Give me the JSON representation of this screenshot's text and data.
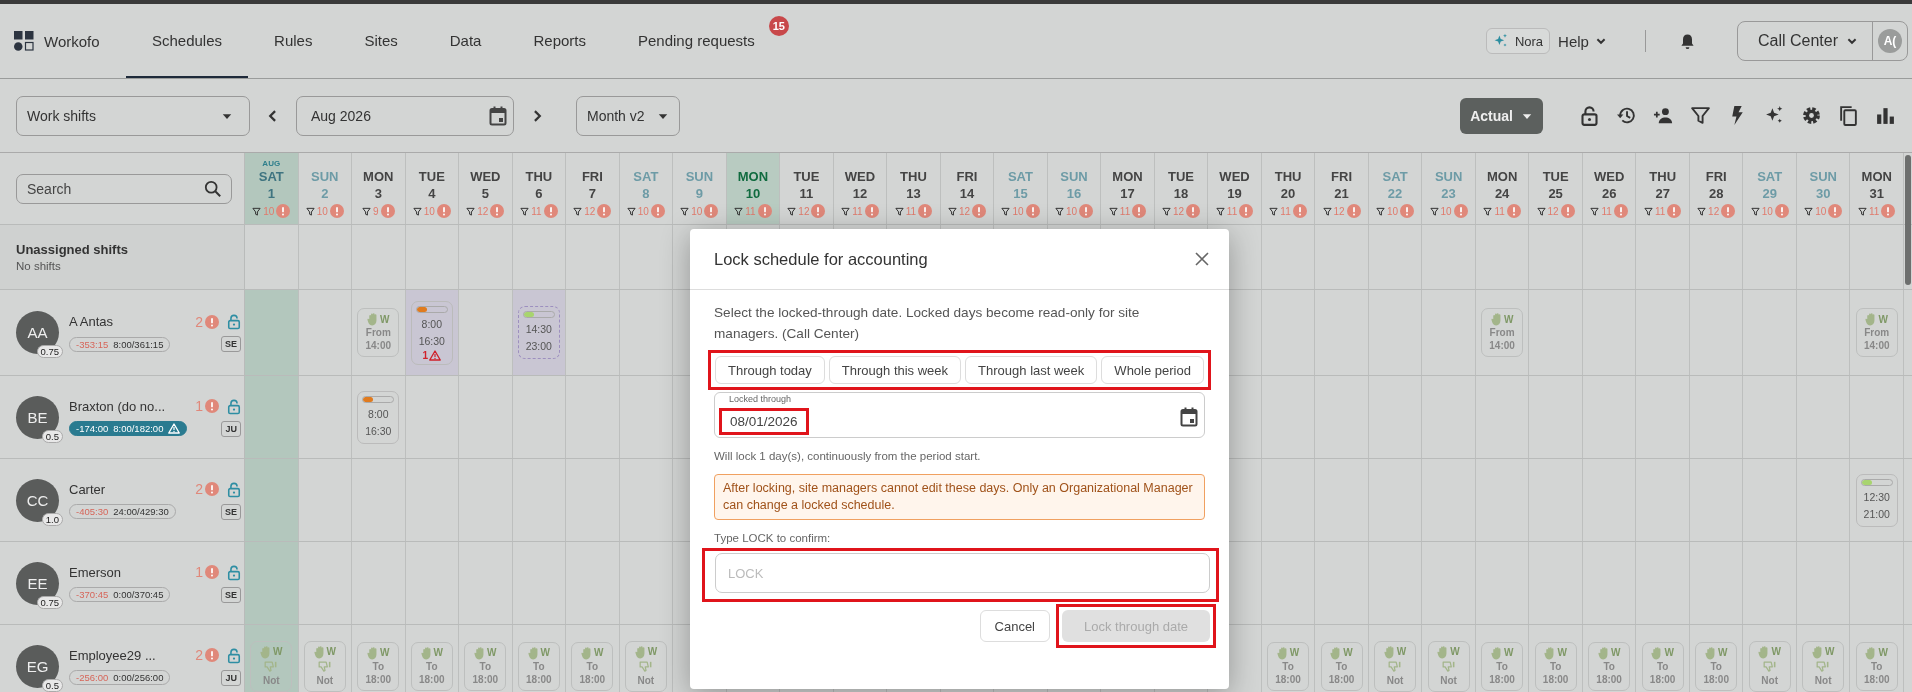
{
  "nav": {
    "logo": "Workofo",
    "assistant": "Nora",
    "help": "Help",
    "site": "Call Center",
    "avatar": "A(",
    "tabs": [
      {
        "label": "Schedules",
        "selected": true
      },
      {
        "label": "Rules",
        "selected": false
      },
      {
        "label": "Sites",
        "selected": false
      },
      {
        "label": "Data",
        "selected": false
      },
      {
        "label": "Reports",
        "selected": false
      },
      {
        "label": "Pending requests",
        "selected": false,
        "badge": "15"
      }
    ]
  },
  "toolbar": {
    "view_select": "Work shifts",
    "period": "Aug 2026",
    "mode_select": "Month v2",
    "scenario": "Actual"
  },
  "search": {
    "placeholder": "Search"
  },
  "unassigned": {
    "title": "Unassigned shifts",
    "subtitle": "No shifts"
  },
  "days": [
    {
      "weekday": "SAT",
      "date": "1",
      "count": "10",
      "weekend": true,
      "today": false,
      "locked": true,
      "month": "AUG"
    },
    {
      "weekday": "SUN",
      "date": "2",
      "count": "10",
      "weekend": true,
      "today": false,
      "locked": false
    },
    {
      "weekday": "MON",
      "date": "3",
      "count": "9",
      "weekend": false,
      "today": false,
      "locked": false
    },
    {
      "weekday": "TUE",
      "date": "4",
      "count": "10",
      "weekend": false,
      "today": false,
      "locked": false
    },
    {
      "weekday": "WED",
      "date": "5",
      "count": "12",
      "weekend": false,
      "today": false,
      "locked": false
    },
    {
      "weekday": "THU",
      "date": "6",
      "count": "11",
      "weekend": false,
      "today": false,
      "locked": false
    },
    {
      "weekday": "FRI",
      "date": "7",
      "count": "12",
      "weekend": false,
      "today": false,
      "locked": false
    },
    {
      "weekday": "SAT",
      "date": "8",
      "count": "10",
      "weekend": true,
      "today": false,
      "locked": false
    },
    {
      "weekday": "SUN",
      "date": "9",
      "count": "10",
      "weekend": true,
      "today": false,
      "locked": false
    },
    {
      "weekday": "MON",
      "date": "10",
      "count": "11",
      "weekend": false,
      "today": true,
      "locked": false
    },
    {
      "weekday": "TUE",
      "date": "11",
      "count": "12",
      "weekend": false,
      "today": false,
      "locked": false
    },
    {
      "weekday": "WED",
      "date": "12",
      "count": "11",
      "weekend": false,
      "today": false,
      "locked": false
    },
    {
      "weekday": "THU",
      "date": "13",
      "count": "11",
      "weekend": false,
      "today": false,
      "locked": false
    },
    {
      "weekday": "FRI",
      "date": "14",
      "count": "12",
      "weekend": false,
      "today": false,
      "locked": false
    },
    {
      "weekday": "SAT",
      "date": "15",
      "count": "10",
      "weekend": true,
      "today": false,
      "locked": false
    },
    {
      "weekday": "SUN",
      "date": "16",
      "count": "10",
      "weekend": true,
      "today": false,
      "locked": false
    },
    {
      "weekday": "MON",
      "date": "17",
      "count": "11",
      "weekend": false,
      "today": false,
      "locked": false
    },
    {
      "weekday": "TUE",
      "date": "18",
      "count": "12",
      "weekend": false,
      "today": false,
      "locked": false
    },
    {
      "weekday": "WED",
      "date": "19",
      "count": "11",
      "weekend": false,
      "today": false,
      "locked": false
    },
    {
      "weekday": "THU",
      "date": "20",
      "count": "11",
      "weekend": false,
      "today": false,
      "locked": false
    },
    {
      "weekday": "FRI",
      "date": "21",
      "count": "12",
      "weekend": false,
      "today": false,
      "locked": false
    },
    {
      "weekday": "SAT",
      "date": "22",
      "count": "10",
      "weekend": true,
      "today": false,
      "locked": false
    },
    {
      "weekday": "SUN",
      "date": "23",
      "count": "10",
      "weekend": true,
      "today": false,
      "locked": false
    },
    {
      "weekday": "MON",
      "date": "24",
      "count": "11",
      "weekend": false,
      "today": false,
      "locked": false
    },
    {
      "weekday": "TUE",
      "date": "25",
      "count": "12",
      "weekend": false,
      "today": false,
      "locked": false
    },
    {
      "weekday": "WED",
      "date": "26",
      "count": "11",
      "weekend": false,
      "today": false,
      "locked": false
    },
    {
      "weekday": "THU",
      "date": "27",
      "count": "11",
      "weekend": false,
      "today": false,
      "locked": false
    },
    {
      "weekday": "FRI",
      "date": "28",
      "count": "12",
      "weekend": false,
      "today": false,
      "locked": false
    },
    {
      "weekday": "SAT",
      "date": "29",
      "count": "10",
      "weekend": true,
      "today": false,
      "locked": false
    },
    {
      "weekday": "SUN",
      "date": "30",
      "count": "10",
      "weekend": true,
      "today": false,
      "locked": false
    },
    {
      "weekday": "MON",
      "date": "31",
      "count": "11",
      "weekend": false,
      "today": false,
      "locked": false
    }
  ],
  "employees": [
    {
      "initials": "AA",
      "fte": "0.75",
      "name": "A Antas",
      "warnings": "2",
      "deficit": "-353:15",
      "hours": "8:00/361:15",
      "alert": false,
      "tag": "SE",
      "cells": [
        {
          "kind": "empty"
        },
        {
          "kind": "empty"
        },
        {
          "kind": "preference",
          "label": "From",
          "time": "14:00",
          "code": "W",
          "dislike": false
        },
        {
          "kind": "shift",
          "start": "8:00",
          "end": "16:30",
          "color": "#e07b1f",
          "dashed": false,
          "highlight": true,
          "warnings": "1"
        },
        {
          "kind": "empty"
        },
        {
          "kind": "shift",
          "start": "14:30",
          "end": "23:00",
          "color": "#a8d46f",
          "dashed": true,
          "highlight": true
        },
        {
          "kind": "empty"
        },
        {
          "kind": "empty"
        },
        {
          "kind": "empty"
        },
        {
          "kind": "empty"
        },
        {
          "kind": "empty"
        },
        {
          "kind": "empty"
        },
        {
          "kind": "empty"
        },
        {
          "kind": "empty"
        },
        {
          "kind": "empty"
        },
        {
          "kind": "empty"
        },
        {
          "kind": "empty"
        },
        {
          "kind": "empty"
        },
        {
          "kind": "empty"
        },
        {
          "kind": "empty"
        },
        {
          "kind": "empty"
        },
        {
          "kind": "empty"
        },
        {
          "kind": "empty"
        },
        {
          "kind": "preference",
          "label": "From",
          "time": "14:00",
          "code": "W",
          "dislike": false
        },
        {
          "kind": "empty"
        },
        {
          "kind": "empty"
        },
        {
          "kind": "empty"
        },
        {
          "kind": "empty"
        },
        {
          "kind": "empty"
        },
        {
          "kind": "empty"
        },
        {
          "kind": "preference",
          "label": "From",
          "time": "14:00",
          "code": "W",
          "dislike": false
        }
      ]
    },
    {
      "initials": "BE",
      "fte": "0.5",
      "name": "Braxton (do no...",
      "warnings": "1",
      "deficit": "-174:00",
      "hours": "8:00/182:00",
      "alert": true,
      "tag": "JU",
      "cells": [
        {
          "kind": "empty"
        },
        {
          "kind": "empty"
        },
        {
          "kind": "shift",
          "start": "8:00",
          "end": "16:30",
          "color": "#e07b1f",
          "dashed": false,
          "highlight": false
        }
      ]
    },
    {
      "initials": "CC",
      "fte": "1.0",
      "name": "Carter",
      "warnings": "2",
      "deficit": "-405:30",
      "hours": "24:00/429:30",
      "alert": false,
      "tag": "SE",
      "cells": [
        {
          "kind": "empty"
        },
        {
          "kind": "empty"
        },
        {
          "kind": "empty"
        },
        {
          "kind": "empty"
        },
        {
          "kind": "empty"
        },
        {
          "kind": "empty"
        },
        {
          "kind": "empty"
        },
        {
          "kind": "empty"
        },
        {
          "kind": "empty"
        },
        {
          "kind": "empty"
        },
        {
          "kind": "empty"
        },
        {
          "kind": "empty"
        },
        {
          "kind": "empty"
        },
        {
          "kind": "empty"
        },
        {
          "kind": "empty"
        },
        {
          "kind": "empty"
        },
        {
          "kind": "empty"
        },
        {
          "kind": "empty"
        },
        {
          "kind": "empty"
        },
        {
          "kind": "empty"
        },
        {
          "kind": "empty"
        },
        {
          "kind": "empty"
        },
        {
          "kind": "empty"
        },
        {
          "kind": "empty"
        },
        {
          "kind": "empty"
        },
        {
          "kind": "empty"
        },
        {
          "kind": "empty"
        },
        {
          "kind": "empty"
        },
        {
          "kind": "empty"
        },
        {
          "kind": "empty"
        },
        {
          "kind": "shift",
          "start": "12:30",
          "end": "21:00",
          "color": "#a8d46f",
          "dashed": false,
          "highlight": false
        }
      ]
    },
    {
      "initials": "EE",
      "fte": "0.75",
      "name": "Emerson",
      "warnings": "1",
      "deficit": "-370:45",
      "hours": "0:00/370:45",
      "alert": false,
      "tag": "SE"
    },
    {
      "initials": "EG",
      "fte": "0.5",
      "name": "Employee29 ...",
      "warnings": "2",
      "deficit": "-256:00",
      "hours": "0:00/256:00",
      "alert": false,
      "tag": "JU",
      "cells": [
        {
          "kind": "preference",
          "label": "Not",
          "code": "W",
          "dislike": true
        },
        {
          "kind": "preference",
          "label": "Not",
          "code": "W",
          "dislike": true
        },
        {
          "kind": "preference",
          "label": "To",
          "time": "18:00",
          "code": "W",
          "dislike": false
        },
        {
          "kind": "preference",
          "label": "To",
          "time": "18:00",
          "code": "W",
          "dislike": false
        },
        {
          "kind": "preference",
          "label": "To",
          "time": "18:00",
          "code": "W",
          "dislike": false
        },
        {
          "kind": "preference",
          "label": "To",
          "time": "18:00",
          "code": "W",
          "dislike": false
        },
        {
          "kind": "preference",
          "label": "To",
          "time": "18:00",
          "code": "W",
          "dislike": false
        },
        {
          "kind": "preference",
          "label": "Not",
          "code": "W",
          "dislike": true
        },
        {
          "kind": "empty"
        },
        {
          "kind": "empty"
        },
        {
          "kind": "empty"
        },
        {
          "kind": "empty"
        },
        {
          "kind": "empty"
        },
        {
          "kind": "empty"
        },
        {
          "kind": "empty"
        },
        {
          "kind": "empty"
        },
        {
          "kind": "empty"
        },
        {
          "kind": "empty"
        },
        {
          "kind": "empty"
        },
        {
          "kind": "preference",
          "label": "To",
          "time": "18:00",
          "code": "W",
          "dislike": false
        },
        {
          "kind": "preference",
          "label": "To",
          "time": "18:00",
          "code": "W",
          "dislike": false
        },
        {
          "kind": "preference",
          "label": "Not",
          "code": "W",
          "dislike": true
        },
        {
          "kind": "preference",
          "label": "Not",
          "code": "W",
          "dislike": true
        },
        {
          "kind": "preference",
          "label": "To",
          "time": "18:00",
          "code": "W",
          "dislike": false
        },
        {
          "kind": "preference",
          "label": "To",
          "time": "18:00",
          "code": "W",
          "dislike": false
        },
        {
          "kind": "preference",
          "label": "To",
          "time": "18:00",
          "code": "W",
          "dislike": false
        },
        {
          "kind": "preference",
          "label": "To",
          "time": "18:00",
          "code": "W",
          "dislike": false
        },
        {
          "kind": "preference",
          "label": "To",
          "time": "18:00",
          "code": "W",
          "dislike": false
        },
        {
          "kind": "preference",
          "label": "Not",
          "code": "W",
          "dislike": true
        },
        {
          "kind": "preference",
          "label": "Not",
          "code": "W",
          "dislike": true
        },
        {
          "kind": "preference",
          "label": "To",
          "time": "18:00",
          "code": "W",
          "dislike": false
        }
      ]
    }
  ],
  "dialog": {
    "title": "Lock schedule for accounting",
    "intro": "Select the locked-through date. Locked days become read-only for site managers. (Call Center)",
    "presets": [
      "Through today",
      "Through this week",
      "Through last week",
      "Whole period"
    ],
    "presets_marked": true,
    "date_field": {
      "label": "Locked through",
      "value": "08/01/2026",
      "marked": true
    },
    "hint": "Will lock 1 day(s), continuously from the period start.",
    "warning": "After locking, site managers cannot edit these days. Only an Organizational Manager can change a locked schedule.",
    "confirm": {
      "label": "Type LOCK to confirm:",
      "placeholder": "LOCK",
      "marked": true
    },
    "buttons": [
      {
        "label": "Cancel",
        "kind": "secondary",
        "disabled": false,
        "marked": false
      },
      {
        "label": "Lock through date",
        "kind": "primary",
        "disabled": true,
        "marked": true
      }
    ]
  }
}
